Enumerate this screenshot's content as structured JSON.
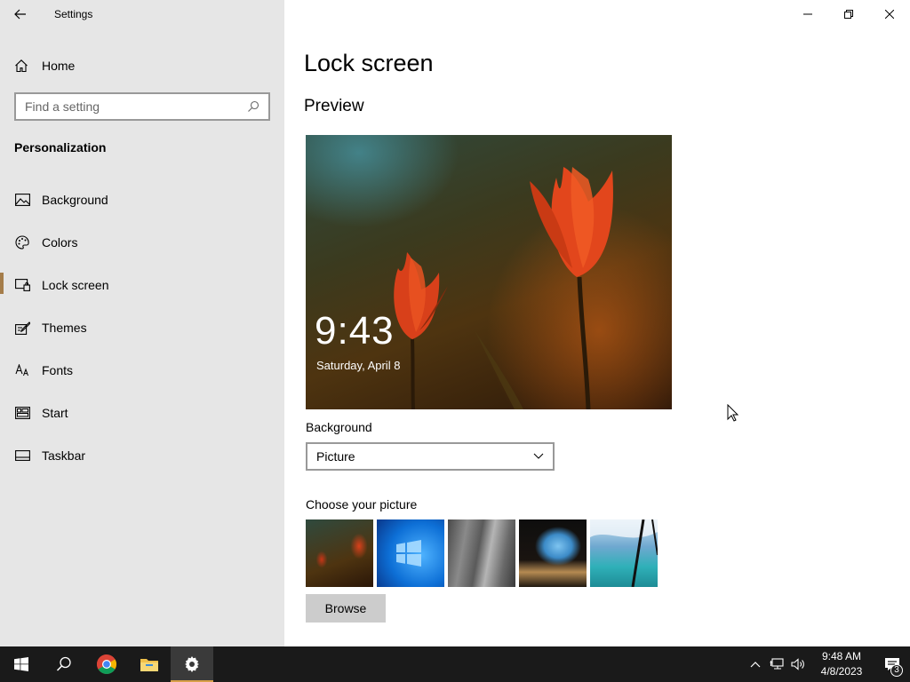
{
  "window": {
    "title": "Settings"
  },
  "sidebar": {
    "home_label": "Home",
    "search_placeholder": "Find a setting",
    "section_title": "Personalization",
    "items": [
      {
        "label": "Background",
        "icon": "picture-icon"
      },
      {
        "label": "Colors",
        "icon": "palette-icon"
      },
      {
        "label": "Lock screen",
        "icon": "lock-screen-icon"
      },
      {
        "label": "Themes",
        "icon": "themes-icon"
      },
      {
        "label": "Fonts",
        "icon": "fonts-icon"
      },
      {
        "label": "Start",
        "icon": "start-icon"
      },
      {
        "label": "Taskbar",
        "icon": "taskbar-icon"
      }
    ],
    "active_item": "Lock screen",
    "accent_color": "#a57d4a"
  },
  "main": {
    "page_title": "Lock screen",
    "preview_heading": "Preview",
    "preview": {
      "time": "9:43",
      "date": "Saturday, April 8"
    },
    "background_label": "Background",
    "background_value": "Picture",
    "choose_label": "Choose your picture",
    "thumbnails": [
      "tulips",
      "windows-logo",
      "rock",
      "cave-beach",
      "sea-window"
    ],
    "browse_label": "Browse"
  },
  "taskbar": {
    "apps": [
      "start-icon",
      "search-icon",
      "chrome-icon",
      "file-explorer-icon",
      "settings-icon"
    ],
    "active_app": "settings-icon",
    "clock_time": "9:48 AM",
    "clock_date": "4/8/2023",
    "notification_count": "3"
  }
}
